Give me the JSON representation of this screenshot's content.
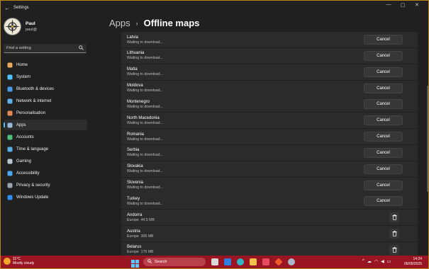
{
  "window": {
    "title": "Settings",
    "back_glyph": "←",
    "controls": [
      "—",
      "▢",
      "✕"
    ]
  },
  "profile": {
    "name": "Paul",
    "email": "paul@"
  },
  "search": {
    "placeholder": "Find a setting"
  },
  "nav": [
    {
      "label": "Home",
      "icon": "home-icon",
      "color": "#e9a85b"
    },
    {
      "label": "System",
      "icon": "monitor-icon",
      "color": "#4cc2ff"
    },
    {
      "label": "Bluetooth & devices",
      "icon": "bluetooth-icon",
      "color": "#4a9be8"
    },
    {
      "label": "Network & internet",
      "icon": "wifi-icon",
      "color": "#5fb0e8"
    },
    {
      "label": "Personalisation",
      "icon": "brush-icon",
      "color": "#e88a54"
    },
    {
      "label": "Apps",
      "icon": "apps-icon",
      "color": "#9ab8d8",
      "active": true
    },
    {
      "label": "Accounts",
      "icon": "person-icon",
      "color": "#4ec07a"
    },
    {
      "label": "Time & language",
      "icon": "globe-clock-icon",
      "color": "#5aaee8"
    },
    {
      "label": "Gaming",
      "icon": "gamepad-icon",
      "color": "#b8c4d0"
    },
    {
      "label": "Accessibility",
      "icon": "accessibility-icon",
      "color": "#4aa8f0"
    },
    {
      "label": "Privacy & security",
      "icon": "shield-icon",
      "color": "#9aa4b0"
    },
    {
      "label": "Windows Update",
      "icon": "update-icon",
      "color": "#2f8ff0"
    }
  ],
  "breadcrumb": {
    "parent": "Apps",
    "separator": "›",
    "current": "Offline maps"
  },
  "downloading": [
    {
      "name": "Latvia",
      "status": "Waiting to download...",
      "action": "Cancel"
    },
    {
      "name": "Lithuania",
      "status": "Waiting to download...",
      "action": "Cancel"
    },
    {
      "name": "Malta",
      "status": "Waiting to download...",
      "action": "Cancel"
    },
    {
      "name": "Moldova",
      "status": "Waiting to download...",
      "action": "Cancel"
    },
    {
      "name": "Montenegro",
      "status": "Waiting to download...",
      "action": "Cancel"
    },
    {
      "name": "North Macedonia",
      "status": "Waiting to download...",
      "action": "Cancel"
    },
    {
      "name": "Romania",
      "status": "Waiting to download...",
      "action": "Cancel"
    },
    {
      "name": "Serbia",
      "status": "Waiting to download...",
      "action": "Cancel"
    },
    {
      "name": "Slovakia",
      "status": "Waiting to download...",
      "action": "Cancel"
    },
    {
      "name": "Slovenia",
      "status": "Waiting to download...",
      "action": "Cancel"
    },
    {
      "name": "Turkey",
      "status": "Waiting to download...",
      "action": "Cancel"
    }
  ],
  "downloaded": [
    {
      "name": "Andorra",
      "region": "Europe",
      "size": "44.5 MB"
    },
    {
      "name": "Austria",
      "region": "Europe",
      "size": "305 MB"
    },
    {
      "name": "Belarus",
      "region": "Europe",
      "size": "175 MB"
    }
  ],
  "taskbar": {
    "weather_temp": "11°C",
    "weather_desc": "Mostly cloudy",
    "search_label": "Search",
    "time": "14:24",
    "date": "06/05/2025",
    "accent": "#9a1522"
  }
}
